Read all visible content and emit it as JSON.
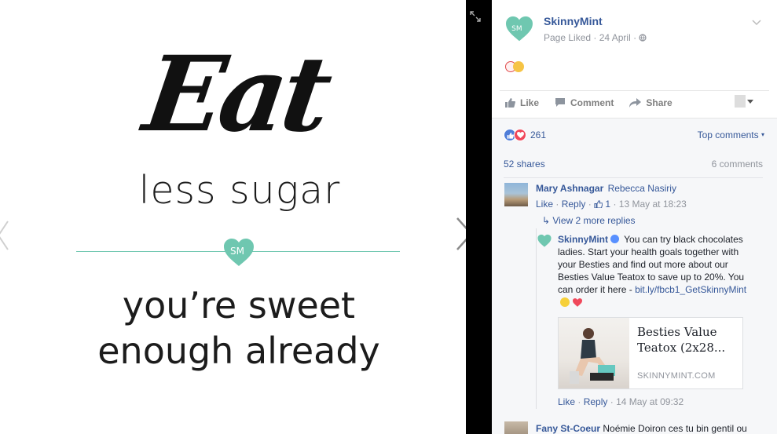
{
  "photo": {
    "line_eat": "Eat",
    "line_less_sugar": "less sugar",
    "logo_text": "SM",
    "line_sweet_1": "you’re sweet",
    "line_sweet_2": "enough already"
  },
  "post": {
    "page_name": "SkinnyMint",
    "meta": "Page Liked · 24 April · ",
    "actions": {
      "like": "Like",
      "comment": "Comment",
      "share": "Share"
    }
  },
  "engagement": {
    "reaction_count": "261",
    "sort_label": "Top comments",
    "shares": "52 shares",
    "comments": "6 comments"
  },
  "comments": [
    {
      "author": "Mary Ashnagar",
      "tag": "Rebecca Nasiriy",
      "like": "Like",
      "reply": "Reply",
      "likes": "1",
      "time": "13 May at 18:23",
      "view_more": "View 2 more replies"
    },
    {
      "author": "SkinnyMint",
      "text": "You can try black chocolates ladies. Start your health goals together with your Besties and find out more about our Besties Value Teatox to save up to 20%. You can order it here -",
      "link": "bit.ly/fbcb1_GetSkinnyMint",
      "card_title": "Besties Value Teatox (2x28...",
      "card_domain": "SKINNYMINT.COM",
      "like": "Like",
      "reply": "Reply",
      "time": "14 May at 09:32"
    },
    {
      "author": "Fany St-Coeur",
      "text": "Noémie Doiron ces tu bin gentil ou"
    }
  ],
  "colors": {
    "brand_mint": "#6fc7b0",
    "link_blue": "#365899",
    "meta_gray": "#90949c"
  }
}
